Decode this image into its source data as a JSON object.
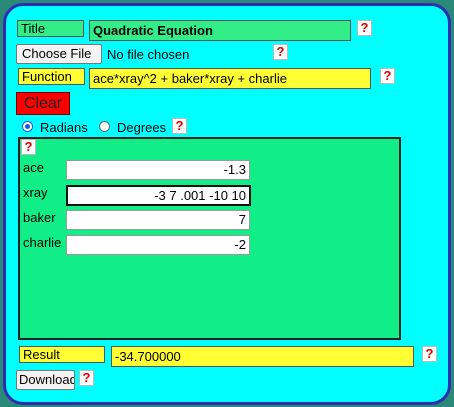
{
  "title_label": "Title",
  "title_value": "Quadratic Equation",
  "file": {
    "button": "Choose File",
    "status": "No file chosen"
  },
  "function_label": "Function",
  "function_value": "ace*xray^2 + baker*xray + charlie",
  "clear_label": "Clear",
  "angle": {
    "radians": "Radians",
    "degrees": "Degrees",
    "selected": "Radians"
  },
  "help_mark": "?",
  "variables": [
    {
      "name": "ace",
      "value": "-1.3"
    },
    {
      "name": "xray",
      "value": "-3 7 .001 -10 10"
    },
    {
      "name": "baker",
      "value": "7"
    },
    {
      "name": "charlie",
      "value": "-2"
    }
  ],
  "result_label": "Result",
  "result_value": "-34.700000",
  "download_label": "Download",
  "colors": {
    "background": "#00ffff",
    "frame": "#2e2eb0",
    "label_yellow": "#ffff33",
    "label_green": "#33ee88",
    "variables_area": "#11ee88",
    "clear_button": "#ff0000",
    "help_mark": "#e00000"
  }
}
